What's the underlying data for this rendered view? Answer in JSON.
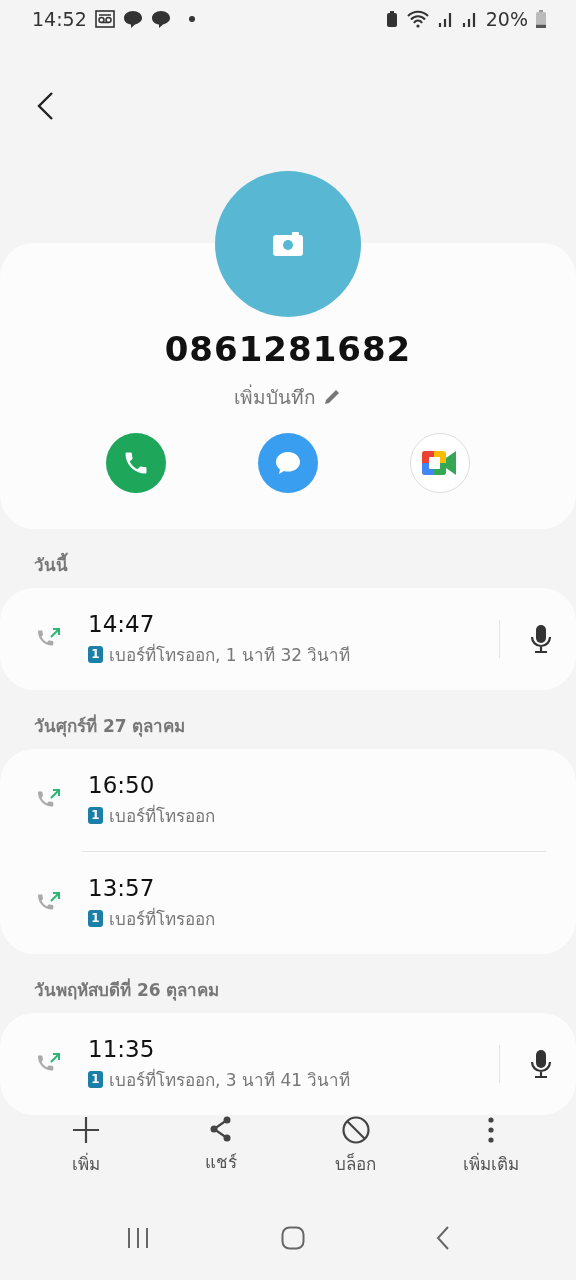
{
  "status_bar": {
    "time": "14:52",
    "battery": "20%"
  },
  "contact": {
    "number": "0861281682",
    "note_action": "เพิ่มบันทึก"
  },
  "quick_actions": [
    {
      "kind": "call"
    },
    {
      "kind": "message"
    },
    {
      "kind": "video"
    }
  ],
  "sections": [
    {
      "header": "วันนี้",
      "calls": [
        {
          "time": "14:47",
          "sim": "1",
          "detail": "เบอร์ที่โทรออก, 1 นาที 32 วินาที",
          "recording": true
        }
      ]
    },
    {
      "header": "วันศุกร์ที่ 27 ตุลาคม",
      "calls": [
        {
          "time": "16:50",
          "sim": "1",
          "detail": "เบอร์ที่โทรออก",
          "recording": false
        },
        {
          "time": "13:57",
          "sim": "1",
          "detail": "เบอร์ที่โทรออก",
          "recording": false
        }
      ]
    },
    {
      "header": "วันพฤหัสบดีที่ 26 ตุลาคม",
      "calls": [
        {
          "time": "11:35",
          "sim": "1",
          "detail": "เบอร์ที่โทรออก, 3 นาที 41 วินาที",
          "recording": true
        }
      ]
    }
  ],
  "bottom_actions": [
    {
      "kind": "add",
      "label": "เพิ่ม"
    },
    {
      "kind": "share",
      "label": "แชร์"
    },
    {
      "kind": "block",
      "label": "บล็อก"
    },
    {
      "kind": "more",
      "label": "เพิ่มเติม"
    }
  ]
}
